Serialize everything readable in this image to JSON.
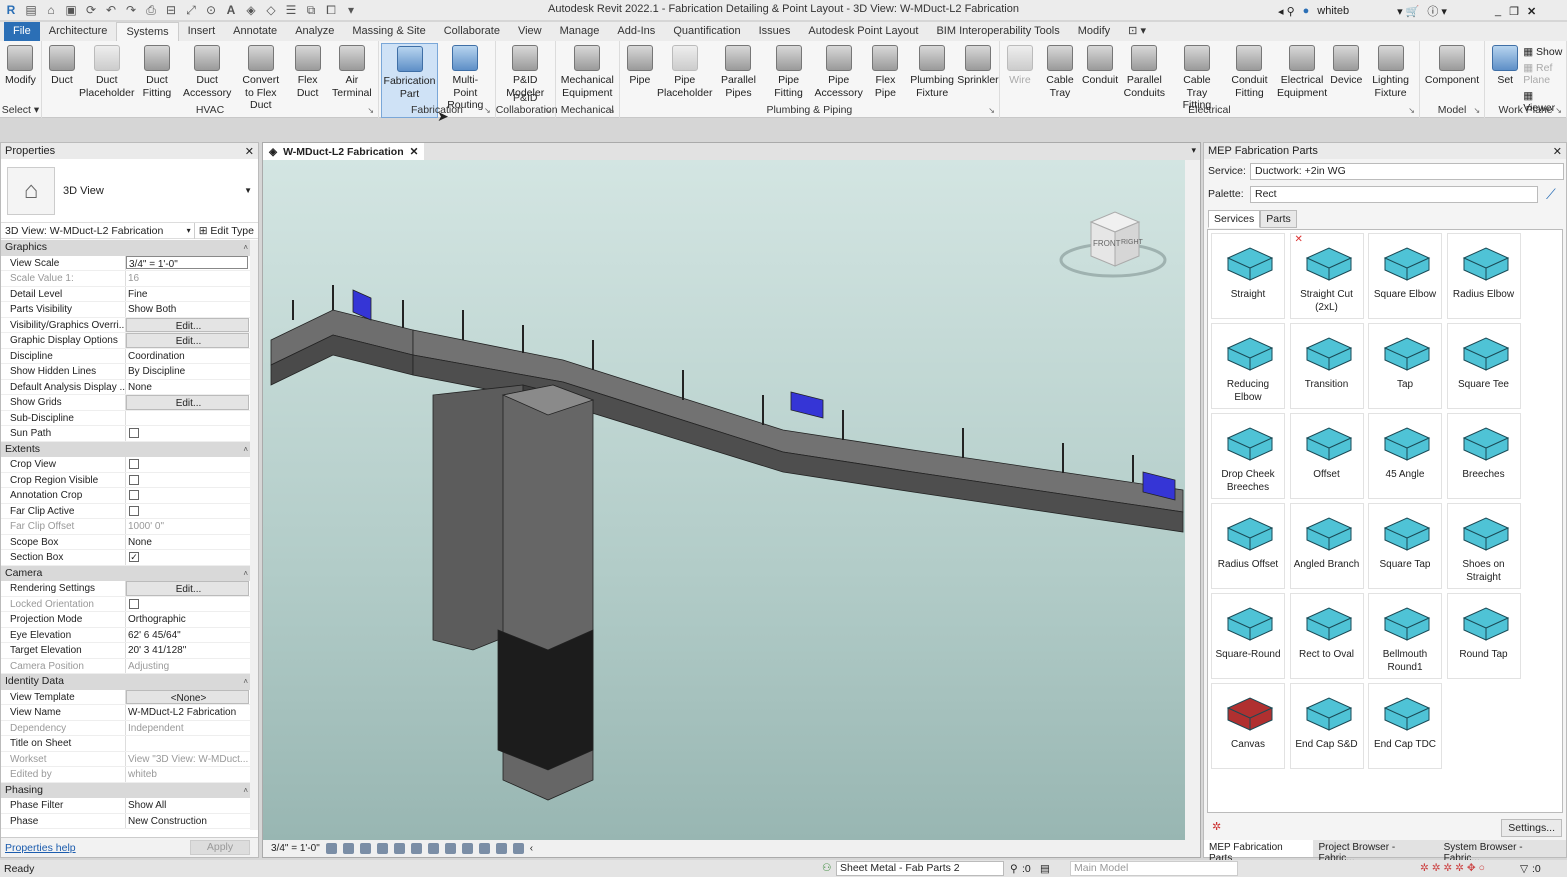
{
  "titlebar": {
    "title": "Autodesk Revit 2022.1 - Fabrication Detailing & Point Layout - 3D View: W-MDuct-L2 Fabrication",
    "user": "whiteb"
  },
  "tabs": [
    "File",
    "Architecture",
    "Systems",
    "Insert",
    "Annotate",
    "Analyze",
    "Massing & Site",
    "Collaborate",
    "View",
    "Manage",
    "Add-Ins",
    "Quantification",
    "Issues",
    "Autodesk Point Layout",
    "BIM Interoperability Tools",
    "Modify"
  ],
  "active_tab": "Systems",
  "ribbon": [
    {
      "label": "Select ▾",
      "buttons": [
        {
          "label": "Modify",
          "icon": "cursor-icon"
        }
      ]
    },
    {
      "label": "HVAC",
      "buttons": [
        {
          "label": "Duct",
          "icon": "duct-icon"
        },
        {
          "label": "Duct Placeholder",
          "icon": "duct-placeholder-icon",
          "light": true
        },
        {
          "label": "Duct Fitting",
          "icon": "duct-fitting-icon"
        },
        {
          "label": "Duct Accessory",
          "icon": "duct-accessory-icon"
        },
        {
          "label": "Convert to Flex Duct",
          "icon": "convert-flex-icon"
        },
        {
          "label": "Flex Duct",
          "icon": "flex-duct-icon"
        },
        {
          "label": "Air Terminal",
          "icon": "air-terminal-icon"
        }
      ]
    },
    {
      "label": "Fabrication",
      "buttons": [
        {
          "label": "Fabrication Part",
          "icon": "fabrication-part-icon",
          "selected": true
        },
        {
          "label": "Multi-Point Routing",
          "icon": "multi-point-routing-icon",
          "blue": true
        }
      ]
    },
    {
      "label": "P&ID Collaboration",
      "buttons": [
        {
          "label": "P&ID Modeler",
          "icon": "pid-modeler-icon"
        }
      ]
    },
    {
      "label": "Mechanical",
      "buttons": [
        {
          "label": "Mechanical Equipment",
          "icon": "mechanical-equipment-icon"
        }
      ]
    },
    {
      "label": "Plumbing & Piping",
      "buttons": [
        {
          "label": "Pipe",
          "icon": "pipe-icon"
        },
        {
          "label": "Pipe Placeholder",
          "icon": "pipe-placeholder-icon",
          "light": true
        },
        {
          "label": "Parallel Pipes",
          "icon": "parallel-pipes-icon"
        },
        {
          "label": "Pipe Fitting",
          "icon": "pipe-fitting-icon"
        },
        {
          "label": "Pipe Accessory",
          "icon": "pipe-accessory-icon"
        },
        {
          "label": "Flex Pipe",
          "icon": "flex-pipe-icon"
        },
        {
          "label": "Plumbing Fixture",
          "icon": "plumbing-fixture-icon"
        },
        {
          "label": "Sprinkler",
          "icon": "sprinkler-icon"
        }
      ]
    },
    {
      "label": "Electrical",
      "buttons": [
        {
          "label": "Wire",
          "icon": "wire-icon",
          "disabled": true
        },
        {
          "label": "Cable Tray",
          "icon": "cable-tray-icon"
        },
        {
          "label": "Conduit",
          "icon": "conduit-icon"
        },
        {
          "label": "Parallel Conduits",
          "icon": "parallel-conduits-icon"
        },
        {
          "label": "Cable Tray Fitting",
          "icon": "cable-tray-fitting-icon"
        },
        {
          "label": "Conduit Fitting",
          "icon": "conduit-fitting-icon"
        },
        {
          "label": "Electrical Equipment",
          "icon": "electrical-equipment-icon"
        },
        {
          "label": "Device",
          "icon": "device-icon"
        },
        {
          "label": "Lighting Fixture",
          "icon": "lighting-fixture-icon"
        }
      ]
    },
    {
      "label": "Model",
      "buttons": [
        {
          "label": "Component",
          "icon": "component-icon"
        }
      ]
    },
    {
      "label": "Work Plane",
      "buttons": [
        {
          "label": "Set",
          "icon": "set-workplane-icon",
          "blue": true
        }
      ],
      "small": [
        {
          "label": "Show"
        },
        {
          "label": "Ref  Plane",
          "disabled": true
        },
        {
          "label": "Viewer"
        }
      ]
    }
  ],
  "properties": {
    "title": "Properties",
    "type_name": "3D View",
    "selector": "3D View: W-MDuct-L2 Fabrication",
    "edit_type": "Edit Type",
    "sections": [
      {
        "name": "Graphics",
        "rows": [
          {
            "k": "View Scale",
            "v": "3/4\" = 1'-0\"",
            "kind": "input"
          },
          {
            "k": "Scale Value    1:",
            "v": "16",
            "dis": true
          },
          {
            "k": "Detail Level",
            "v": "Fine"
          },
          {
            "k": "Parts Visibility",
            "v": "Show Both"
          },
          {
            "k": "Visibility/Graphics Overri...",
            "v": "Edit...",
            "kind": "button"
          },
          {
            "k": "Graphic Display Options",
            "v": "Edit...",
            "kind": "button"
          },
          {
            "k": "Discipline",
            "v": "Coordination"
          },
          {
            "k": "Show Hidden Lines",
            "v": "By Discipline"
          },
          {
            "k": "Default Analysis Display ...",
            "v": "None"
          },
          {
            "k": "Show Grids",
            "v": "Edit...",
            "kind": "button"
          },
          {
            "k": "Sub-Discipline",
            "v": ""
          },
          {
            "k": "Sun Path",
            "v": "",
            "kind": "check",
            "checked": false
          }
        ]
      },
      {
        "name": "Extents",
        "rows": [
          {
            "k": "Crop View",
            "kind": "check",
            "checked": false
          },
          {
            "k": "Crop Region Visible",
            "kind": "check",
            "checked": false
          },
          {
            "k": "Annotation Crop",
            "kind": "check",
            "checked": false
          },
          {
            "k": "Far Clip Active",
            "kind": "check",
            "checked": false
          },
          {
            "k": "Far Clip Offset",
            "v": "1000'  0\"",
            "dis": true
          },
          {
            "k": "Scope Box",
            "v": "None"
          },
          {
            "k": "Section Box",
            "kind": "check",
            "checked": true
          }
        ]
      },
      {
        "name": "Camera",
        "rows": [
          {
            "k": "Rendering Settings",
            "v": "Edit...",
            "kind": "button"
          },
          {
            "k": "Locked Orientation",
            "kind": "check",
            "checked": false,
            "dis": true
          },
          {
            "k": "Projection Mode",
            "v": "Orthographic"
          },
          {
            "k": "Eye Elevation",
            "v": "62'  6 45/64\""
          },
          {
            "k": "Target Elevation",
            "v": "20'  3 41/128\""
          },
          {
            "k": "Camera Position",
            "v": "Adjusting",
            "dis": true
          }
        ]
      },
      {
        "name": "Identity Data",
        "rows": [
          {
            "k": "View Template",
            "v": "<None>",
            "kind": "button"
          },
          {
            "k": "View Name",
            "v": "W-MDuct-L2 Fabrication"
          },
          {
            "k": "Dependency",
            "v": "Independent",
            "dis": true
          },
          {
            "k": "Title on Sheet",
            "v": ""
          },
          {
            "k": "Workset",
            "v": "View \"3D View: W-MDuct...",
            "dis": true
          },
          {
            "k": "Edited by",
            "v": "whiteb",
            "dis": true
          }
        ]
      },
      {
        "name": "Phasing",
        "rows": [
          {
            "k": "Phase Filter",
            "v": "Show All"
          },
          {
            "k": "Phase",
            "v": "New Construction"
          }
        ]
      }
    ],
    "help": "Properties help",
    "apply": "Apply"
  },
  "view": {
    "tab": "W-MDuct-L2 Fabrication",
    "scale": "3/4\" = 1'-0\"",
    "viewcube": {
      "front": "FRONT",
      "right": "RIGHT"
    }
  },
  "mep": {
    "title": "MEP Fabrication Parts",
    "service_label": "Service:",
    "service": "Ductwork: +2in WG",
    "palette_label": "Palette:",
    "palette": "Rect",
    "tabs": [
      "Services",
      "Parts"
    ],
    "parts": [
      "Straight",
      "Straight Cut (2xL)",
      "Square Elbow",
      "Radius Elbow",
      "Reducing Elbow",
      "Transition",
      "Tap",
      "Square Tee",
      "Drop Cheek Breeches",
      "Offset",
      "45 Angle",
      "Breeches",
      "Radius Offset",
      "Angled Branch",
      "Square Tap",
      "Shoes on Straight",
      "Square-Round",
      "Rect to Oval",
      "Bellmouth Round1",
      "Round Tap",
      "Canvas",
      "End Cap S&D",
      "End Cap TDC"
    ],
    "settings": "Settings...",
    "bottom_tabs": [
      "MEP Fabrication Parts",
      "Project Browser - Fabric...",
      "System Browser - Fabric..."
    ]
  },
  "status": {
    "text": "Ready",
    "workset": "Sheet Metal - Fab Parts 2",
    "editable": ":0",
    "model": "Main Model",
    "filter": ":0"
  },
  "colors": {
    "accent": "#2b6fb6",
    "part_fill": "#4fc3d6",
    "duct": "#5a5a5a",
    "viewport_top": "#d3e5e2",
    "viewport_bottom": "#98b6b2"
  }
}
